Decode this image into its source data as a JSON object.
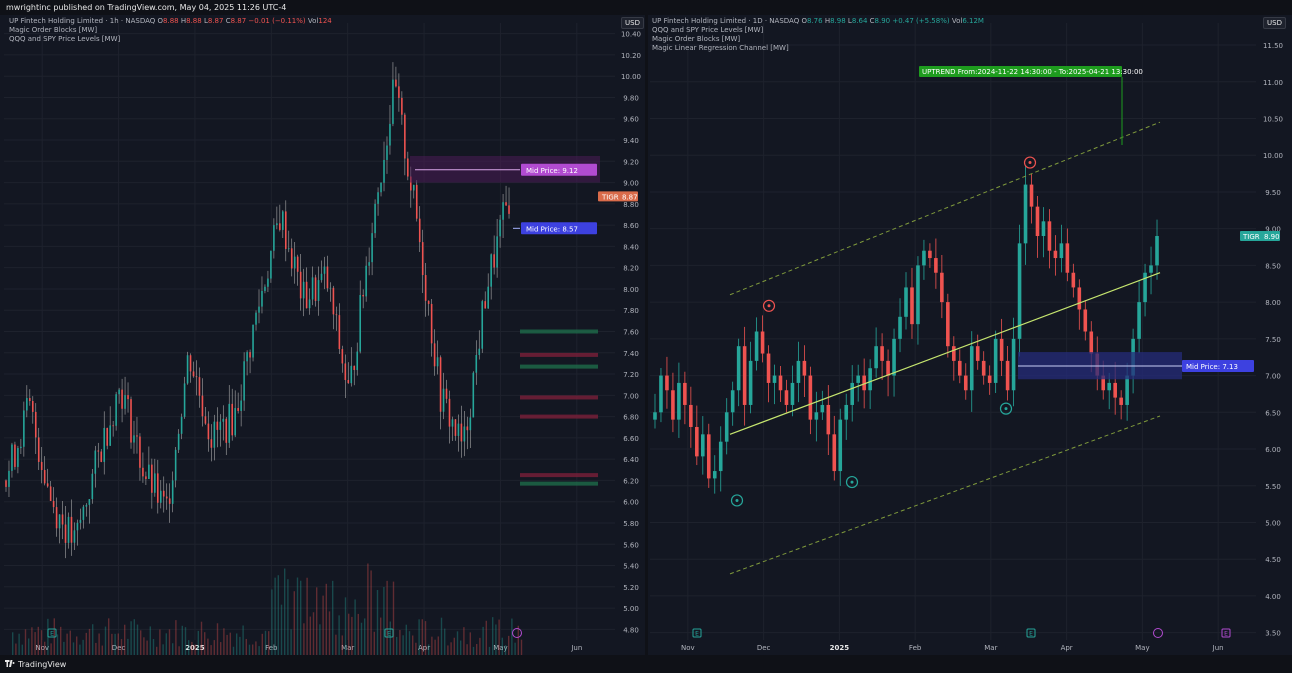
{
  "header": {
    "publisher": "mwrightinc published on TradingView.com, May 04, 2025 11:26 UTC-4"
  },
  "footer": {
    "brand": "TradingView"
  },
  "colors": {
    "bg": "#131722",
    "grid": "#1e222d",
    "up": "#26a69a",
    "down": "#ef5350",
    "mid_purple": "#b24bd1",
    "mid_blue": "#3d41e0",
    "uptrend": "#1e9c1e",
    "regression": "#c6e66f",
    "channel": "#7f9a3c"
  },
  "left_panel": {
    "legend": {
      "line1_name": "UP Fintech Holding Limited · 1h · NASDAQ",
      "o_label": "O",
      "o_val": "8.88",
      "h_label": "H",
      "h_val": "8.88",
      "l_label": "L",
      "l_val": "8.87",
      "c_label": "C",
      "c_val": "8.87",
      "change": "−0.01 (−0.11%)",
      "vol_label": "Vol",
      "vol_val": "124",
      "line2": "Magic Order Blocks [MW]",
      "line3": "QQQ and SPY Price Levels [MW]"
    },
    "currency": "USD",
    "price_ticks": [
      "10.40",
      "10.20",
      "10.00",
      "9.80",
      "9.60",
      "9.40",
      "9.20",
      "9.00",
      "8.80",
      "8.60",
      "8.40",
      "8.20",
      "8.00",
      "7.80",
      "7.60",
      "7.40",
      "7.20",
      "7.00",
      "6.80",
      "6.60",
      "6.40",
      "6.20",
      "6.00",
      "5.80",
      "5.60",
      "5.40",
      "5.20",
      "5.00",
      "4.80"
    ],
    "time_ticks": [
      "Nov",
      "Dec",
      "2025",
      "Feb",
      "Mar",
      "Apr",
      "May",
      "Jun"
    ],
    "last_price_symbol": "TIGR",
    "last_price": "8.87",
    "mid_price_1": "Mid Price: 9.12",
    "mid_price_2": "Mid Price: 8.57",
    "event_e": "E"
  },
  "right_panel": {
    "legend": {
      "line1_name": "UP Fintech Holding Limited · 1D · NASDAQ",
      "o_label": "O",
      "o_val": "8.76",
      "h_label": "H",
      "h_val": "8.98",
      "l_label": "L",
      "l_val": "8.64",
      "c_label": "C",
      "c_val": "8.90",
      "change": "+0.47 (+5.58%)",
      "vol_label": "Vol",
      "vol_val": "6.12M",
      "line2": "QQQ and SPY Price Levels [MW]",
      "line3": "Magic Order Blocks [MW]",
      "line4": "Magic Linear Regression Channel [MW]"
    },
    "currency": "USD",
    "price_ticks": [
      "11.50",
      "11.00",
      "10.50",
      "10.00",
      "9.50",
      "9.00",
      "8.50",
      "8.00",
      "7.50",
      "7.00",
      "6.50",
      "6.00",
      "5.50",
      "5.00",
      "4.50",
      "4.00",
      "3.50"
    ],
    "time_ticks": [
      "Nov",
      "Dec",
      "2025",
      "Feb",
      "Mar",
      "Apr",
      "May",
      "Jun"
    ],
    "last_price_symbol": "TIGR",
    "last_price": "8.90",
    "uptrend_label": "UPTREND From:2024-11-22 14:30:00 - To:2025-04-21 13:30:00",
    "mid_price": "Mid Price: 7.13",
    "event_e": "E"
  },
  "chart_data": [
    {
      "type": "candlestick",
      "timeframe": "1h",
      "symbol": "TIGR",
      "ylim": [
        4.7,
        10.5
      ],
      "x_labels": [
        "Nov",
        "Dec",
        "2025",
        "Feb",
        "Mar",
        "Apr",
        "May",
        "Jun"
      ],
      "last_price": 8.87,
      "order_blocks": [
        {
          "mid": 9.12,
          "low": 9.0,
          "high": 9.25,
          "color": "#b24bd1"
        },
        {
          "mid": 8.57,
          "low": 8.5,
          "high": 8.64,
          "color": "#3d41e0"
        }
      ],
      "close_path": [
        {
          "m": "Nov",
          "v": 6.2
        },
        {
          "m": "Nov",
          "v": 6.9
        },
        {
          "m": "Nov",
          "v": 6.0
        },
        {
          "m": "Nov",
          "v": 5.6
        },
        {
          "m": "Dec",
          "v": 6.4
        },
        {
          "m": "Dec",
          "v": 7.1
        },
        {
          "m": "Dec",
          "v": 6.3
        },
        {
          "m": "Dec",
          "v": 5.9
        },
        {
          "m": "2025",
          "v": 7.4
        },
        {
          "m": "2025",
          "v": 6.6
        },
        {
          "m": "2025",
          "v": 6.8
        },
        {
          "m": "2025",
          "v": 7.8
        },
        {
          "m": "Feb",
          "v": 8.7
        },
        {
          "m": "Feb",
          "v": 7.9
        },
        {
          "m": "Feb",
          "v": 8.1
        },
        {
          "m": "Mar",
          "v": 7.0
        },
        {
          "m": "Mar",
          "v": 8.6
        },
        {
          "m": "Mar",
          "v": 9.9
        },
        {
          "m": "Apr",
          "v": 8.6
        },
        {
          "m": "Apr",
          "v": 7.0
        },
        {
          "m": "Apr",
          "v": 6.5
        },
        {
          "m": "May",
          "v": 8.0
        },
        {
          "m": "May",
          "v": 8.87
        }
      ]
    },
    {
      "type": "candlestick",
      "timeframe": "1D",
      "symbol": "TIGR",
      "ylim": [
        3.4,
        11.8
      ],
      "x_labels": [
        "Nov",
        "Dec",
        "2025",
        "Feb",
        "Mar",
        "Apr",
        "May",
        "Jun"
      ],
      "last_price": 8.9,
      "order_blocks": [
        {
          "mid": 7.13,
          "low": 6.95,
          "high": 7.32,
          "color": "#3d41e0"
        }
      ],
      "regression_line": {
        "start": 6.2,
        "end": 8.4
      },
      "channel_upper": {
        "start": 8.1,
        "end": 10.45
      },
      "channel_lower": {
        "start": 4.3,
        "end": 6.45
      },
      "closes": [
        6.5,
        7.0,
        6.8,
        6.4,
        6.9,
        6.6,
        6.3,
        5.9,
        6.2,
        5.6,
        5.7,
        6.1,
        6.5,
        6.8,
        7.4,
        6.6,
        7.2,
        7.6,
        7.3,
        6.9,
        7.0,
        6.8,
        6.6,
        6.9,
        7.2,
        7.0,
        6.4,
        6.5,
        6.6,
        6.2,
        5.7,
        6.4,
        6.6,
        6.9,
        7.0,
        6.8,
        7.1,
        7.4,
        7.2,
        7.0,
        7.5,
        7.8,
        8.2,
        7.7,
        8.5,
        8.7,
        8.6,
        8.4,
        8.0,
        7.4,
        7.2,
        7.0,
        6.8,
        7.4,
        7.2,
        7.0,
        6.9,
        7.5,
        7.2,
        6.8,
        7.5,
        8.8,
        9.6,
        9.3,
        8.9,
        9.1,
        8.7,
        8.6,
        8.8,
        8.4,
        8.2,
        7.9,
        7.6,
        7.3,
        7.0,
        6.8,
        6.9,
        6.7,
        6.6,
        7.0,
        7.5,
        8.0,
        8.4,
        8.5,
        8.9
      ]
    }
  ]
}
